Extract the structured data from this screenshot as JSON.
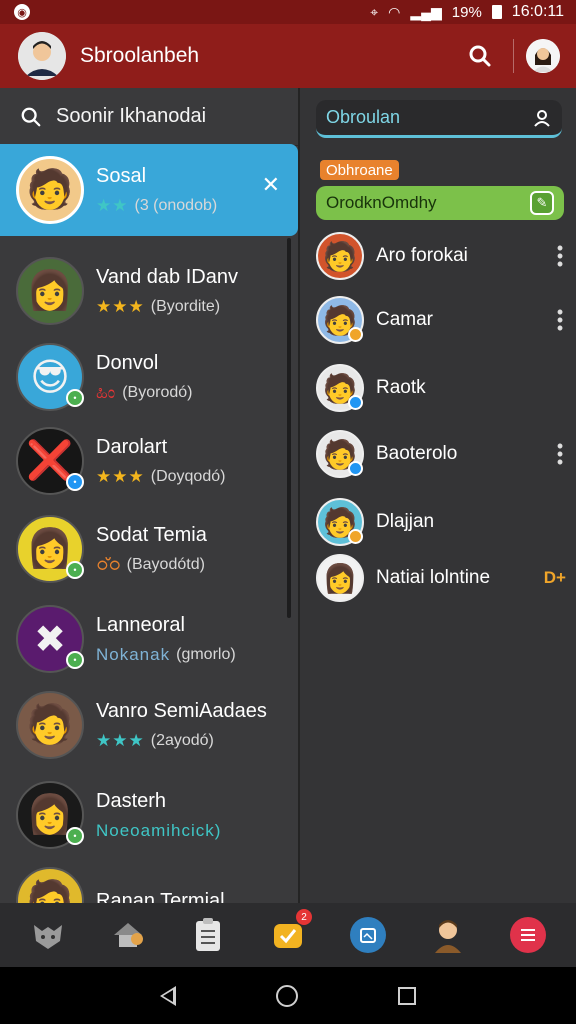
{
  "status_bar": {
    "battery_text": "19%",
    "time": "16:0:11"
  },
  "app_bar": {
    "title": "Sbroolanbeh",
    "avatar_icon": "person-avatar",
    "search_icon": "search-icon",
    "profile_icon": "profile-avatar"
  },
  "left_panel": {
    "search_text": "Soonir Ikhanodai",
    "contacts": [
      {
        "name": "Sosal",
        "rating": "★★",
        "sub": "(3 (onodob)",
        "selected": true,
        "avatar_bg": "#f2c98a",
        "emoji": "🧑"
      },
      {
        "name": "Vand dab IDanv",
        "rating": "★★★",
        "sub": "(Byordite)",
        "avatar_bg": "#4a6b3a",
        "emoji": "👩"
      },
      {
        "name": "Donvol",
        "rating": "ಹಿಂ",
        "sub": "(Byorodó)",
        "avatar_bg": "#39a7d9",
        "emoji": "😎",
        "badge_color": "#4caf50"
      },
      {
        "name": "Darolart",
        "rating": "★★★",
        "sub": "(Doyqodó)",
        "avatar_bg": "#161616",
        "emoji": "❌",
        "badge_color": "#2196f3"
      },
      {
        "name": "Sodat Temia",
        "rating": "ഠ്ഠ",
        "sub": "(Bayodótd)",
        "avatar_bg": "#e8d22c",
        "emoji": "👩",
        "badge_color": "#4caf50"
      },
      {
        "name": "Lanneoral",
        "rating": "Nokanak",
        "sub": "(gmorlo)",
        "avatar_bg": "#5a1b6e",
        "emoji": "✖",
        "badge_color": "#4caf50"
      },
      {
        "name": "Vanro SemiAadaes",
        "rating": "★★★",
        "sub": "(2ayodó)",
        "avatar_bg": "#7a5a48",
        "emoji": "🧑",
        "badge_color": ""
      },
      {
        "name": "Dasterh",
        "rating": "Noeoamihcick)",
        "sub": "",
        "avatar_bg": "#1a1a1a",
        "emoji": "👩",
        "badge_color": "#4caf50"
      },
      {
        "name": "Ranan Termial",
        "rating": "",
        "sub": "",
        "avatar_bg": "#e0b92c",
        "emoji": "🧑"
      }
    ]
  },
  "right_panel": {
    "search_text": "Obroulan",
    "tag_text": "Obhroane",
    "pill_text": "OrodknOmdhy",
    "members": [
      {
        "name": "Aro forokai",
        "avatar_bg": "#d2542c",
        "emoji": "🧑",
        "has_menu": true
      },
      {
        "name": "Camar",
        "avatar_bg": "#8fb9e6",
        "emoji": "🧑",
        "badge_color": "#f0a52a",
        "has_menu": true
      },
      {
        "name": "Raotk",
        "avatar_bg": "#e8e8e8",
        "emoji": "🧑",
        "badge_color": "#2196f3"
      },
      {
        "name": "Baoterolo",
        "avatar_bg": "#e8e8e8",
        "emoji": "🧑",
        "badge_color": "#2196f3",
        "has_menu": true
      },
      {
        "name": "Dlajjan",
        "avatar_bg": "#5ec0d8",
        "emoji": "🧑",
        "badge_color": "#f0a52a"
      },
      {
        "name": "Natiai lolntine",
        "avatar_bg": "#f2f2f2",
        "emoji": "👩",
        "extra": "D+"
      }
    ]
  },
  "bottom_nav": {
    "items": [
      {
        "name": "groups",
        "emoji": "🦊"
      },
      {
        "name": "home",
        "emoji": "🏠"
      },
      {
        "name": "notes",
        "emoji": "📋"
      },
      {
        "name": "tasks",
        "emoji": "✅",
        "badge": "2"
      },
      {
        "name": "calendar",
        "emoji": "📅"
      },
      {
        "name": "profile",
        "emoji": "🧑"
      },
      {
        "name": "menu",
        "emoji": "☰"
      }
    ]
  },
  "colors": {
    "status_bar": "#7a1614",
    "app_bar": "#8f1d1a",
    "selected": "#39a7d9",
    "accent_green": "#7cc14a",
    "accent_orange": "#e8822d"
  }
}
